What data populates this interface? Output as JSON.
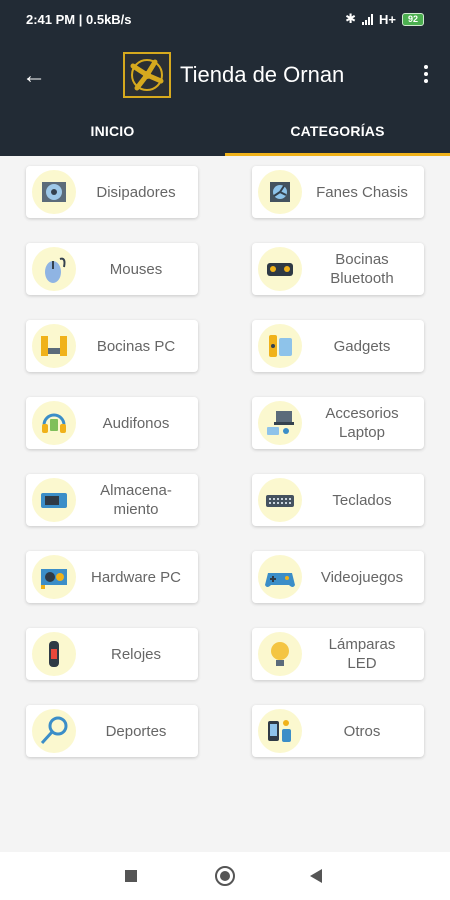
{
  "status_bar": {
    "time_speed": "2:41 PM | 0.5kB/s",
    "network": "H+",
    "battery": "92"
  },
  "app_bar": {
    "title": "Tienda de Ornan"
  },
  "tabs": [
    {
      "label": "INICIO",
      "selected": false
    },
    {
      "label": "CATEGORÍAS",
      "selected": true
    }
  ],
  "colors": {
    "header": "#222b35",
    "accent": "#f0b21a",
    "icon_circle": "#fbf8cf"
  },
  "categories": [
    {
      "label": "Disipadores",
      "icon": "cooler-fan-icon"
    },
    {
      "label": "Fanes Chasis",
      "icon": "case-fan-icon"
    },
    {
      "label": "Mouses",
      "icon": "mouse-icon"
    },
    {
      "label": "Bocinas\nBluetooth",
      "icon": "bluetooth-speaker-icon"
    },
    {
      "label": "Bocinas PC",
      "icon": "pc-speakers-icon"
    },
    {
      "label": "Gadgets",
      "icon": "gadgets-icon"
    },
    {
      "label": "Audifonos",
      "icon": "headphones-icon"
    },
    {
      "label": "Accesorios\nLaptop",
      "icon": "laptop-accessories-icon"
    },
    {
      "label": "Almacena-\nmiento",
      "icon": "ssd-icon"
    },
    {
      "label": "Teclados",
      "icon": "keyboard-icon"
    },
    {
      "label": "Hardware PC",
      "icon": "graphics-card-icon"
    },
    {
      "label": "Videojuegos",
      "icon": "gamepad-icon"
    },
    {
      "label": "Relojes",
      "icon": "smartwatch-icon"
    },
    {
      "label": "Lámparas\nLED",
      "icon": "led-bulb-icon"
    },
    {
      "label": "Deportes",
      "icon": "racket-icon"
    },
    {
      "label": "Otros",
      "icon": "misc-devices-icon"
    }
  ]
}
